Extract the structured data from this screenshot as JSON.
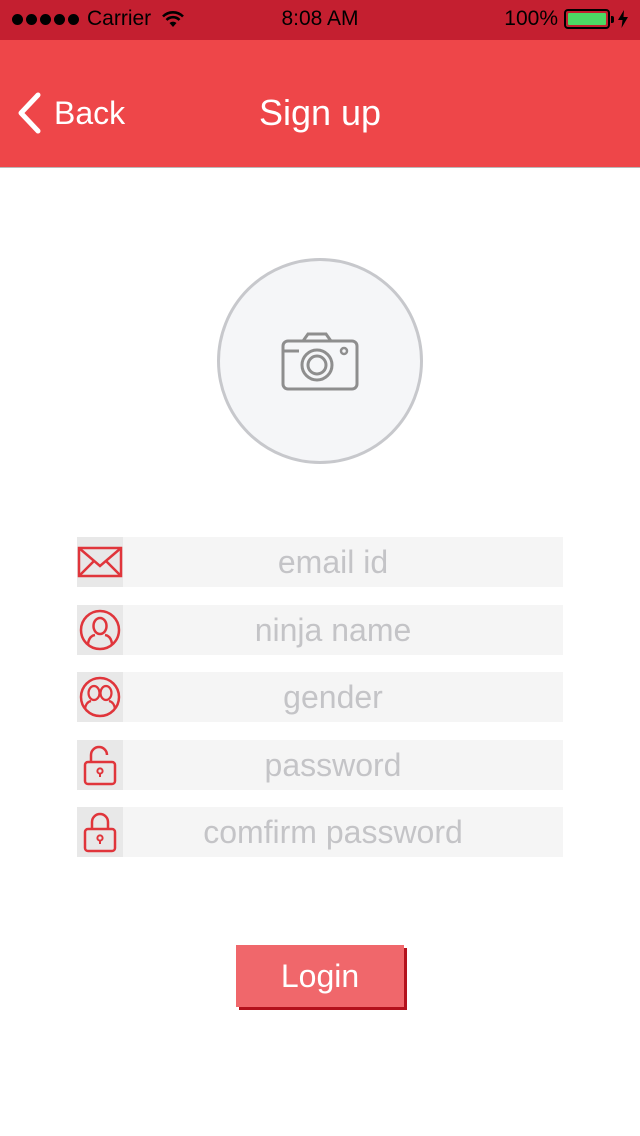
{
  "status_bar": {
    "carrier": "Carrier",
    "time": "8:08 AM",
    "battery": "100%"
  },
  "nav": {
    "back_label": "Back",
    "title": "Sign up"
  },
  "photo": {
    "icon": "camera-icon"
  },
  "form": {
    "fields": [
      {
        "icon": "envelope-icon",
        "placeholder": "email id",
        "value": ""
      },
      {
        "icon": "user-icon",
        "placeholder": "ninja name",
        "value": ""
      },
      {
        "icon": "users-icon",
        "placeholder": "gender",
        "value": ""
      },
      {
        "icon": "lock-open-icon",
        "placeholder": "password",
        "value": ""
      },
      {
        "icon": "lock-icon",
        "placeholder": "comfirm password",
        "value": ""
      }
    ],
    "submit_label": "Login"
  },
  "colors": {
    "status_bar": "#c41f30",
    "nav_bar": "#ee4649",
    "accent_icon": "#e0353b",
    "login_button": "#f0676b",
    "login_shadow": "#b3111c"
  }
}
